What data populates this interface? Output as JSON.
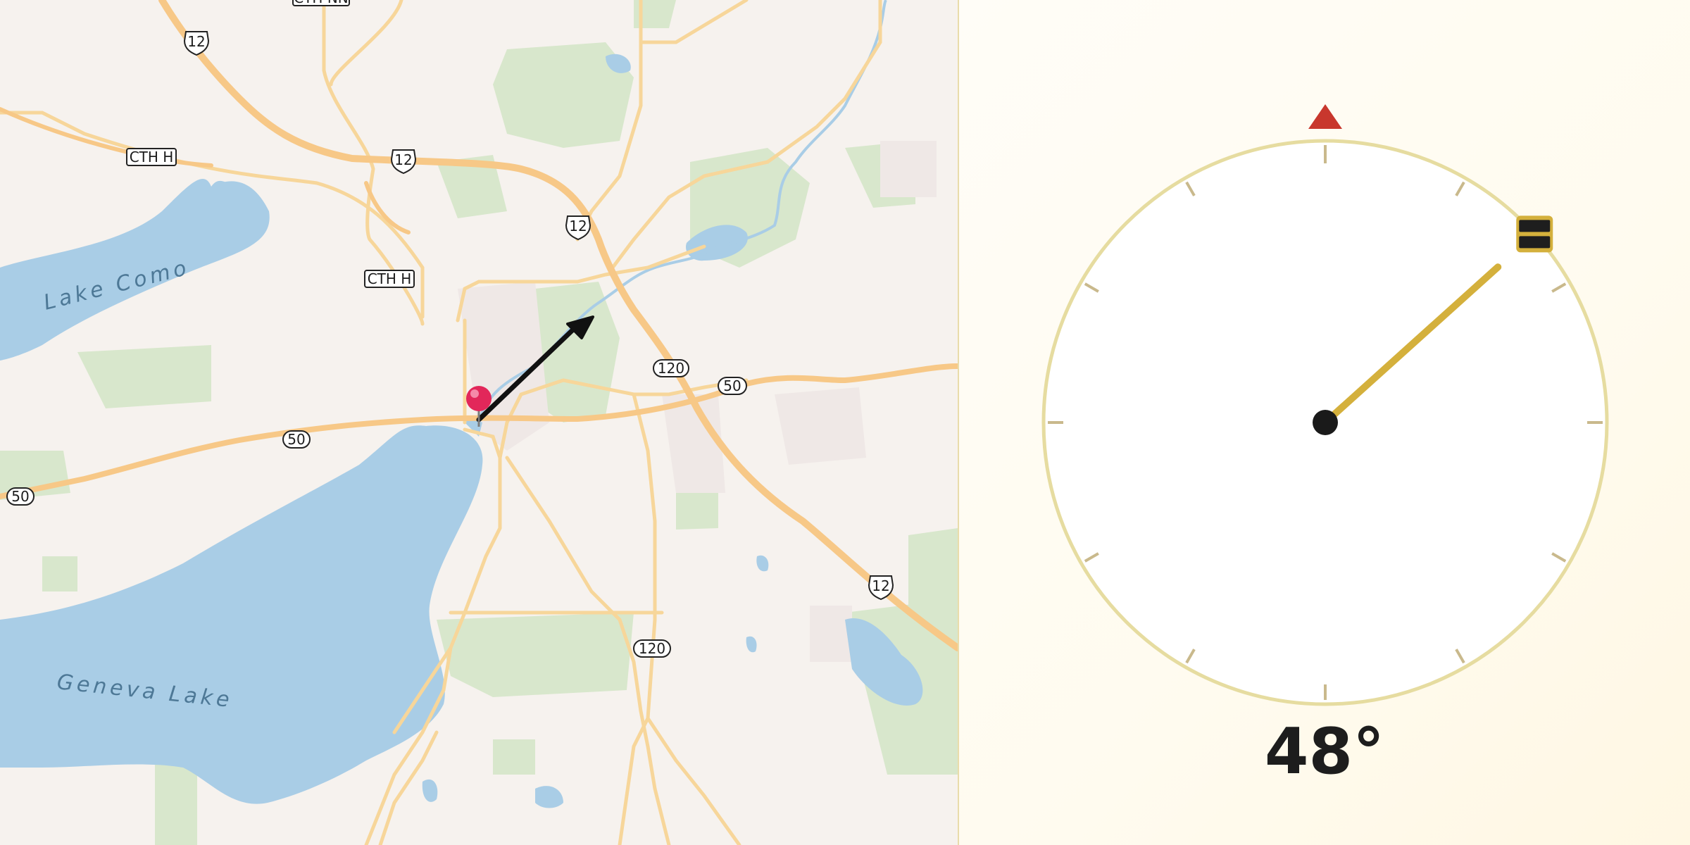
{
  "map": {
    "lakes": [
      {
        "name": "Lake Como"
      },
      {
        "name": "Geneva Lake"
      }
    ],
    "route_shields": [
      "12",
      "12",
      "12",
      "12",
      "50",
      "50",
      "50",
      "120",
      "120"
    ],
    "county_labels": [
      "CTH H",
      "CTH H",
      "CTH NN"
    ],
    "pin_color": "#e2275a",
    "arrow_color": "#111111",
    "colors": {
      "water": "#a9cde6",
      "park": "#d8e7cc",
      "highway": "#f7c887",
      "land": "#f6f2ee"
    }
  },
  "compass": {
    "heading_deg": 48,
    "heading_label": "48°",
    "north_marker_color": "#c8372d",
    "needle_color": "#d4b03c",
    "ring_color": "#e6dca0",
    "tick_color": "#c9b98c"
  }
}
